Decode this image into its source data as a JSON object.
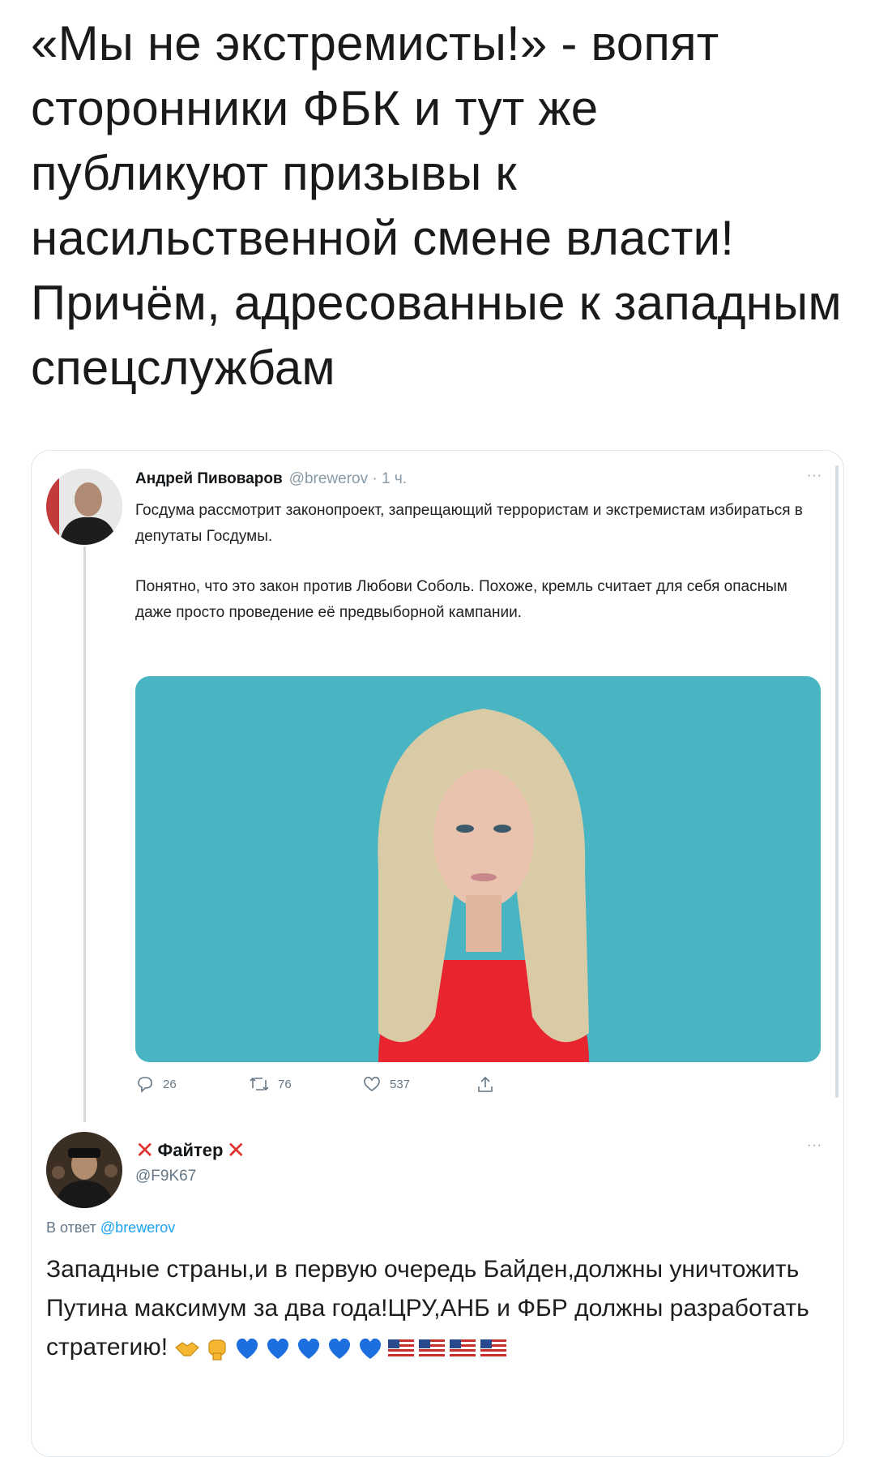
{
  "headline": "«Мы не экстремисты!» - вопят сторонники ФБК и тут же публикуют призывы к насильственной смене власти! Причём, адресованные к западным спецслужбам",
  "tweet1": {
    "name": "Андрей Пивоваров",
    "handle": "@brewerov · 1 ч.",
    "paragraph1": "Госдума рассмотрит законопроект, запрещающий террористам и экстремистам избираться в депутаты Госдумы.",
    "paragraph2": "Понятно, что это закон против Любови Соболь. Похоже, кремль считает для себя опасным даже просто проведение её предвыборной кампании.",
    "replies": "26",
    "retweets": "76",
    "likes": "537",
    "more": "···"
  },
  "tweet2": {
    "name": "Файтер",
    "handle": "@F9K67",
    "reply_prefix": "В ответ",
    "reply_handle": "@brewerov",
    "text": "Западные страны,и в первую очередь Байден,должны уничтожить Путина максимум за два года!ЦРУ,АНБ и ФБР должны разработать стратегию!",
    "more": "···"
  },
  "colors": {
    "accent": "#1da1f2",
    "media_bg": "#49b5c2",
    "red": "#e0322f"
  },
  "icons": [
    "reply-icon",
    "retweet-icon",
    "like-icon",
    "share-icon",
    "handshake-emoji",
    "fist-emoji",
    "blue-heart-emoji",
    "us-flag-emoji"
  ]
}
